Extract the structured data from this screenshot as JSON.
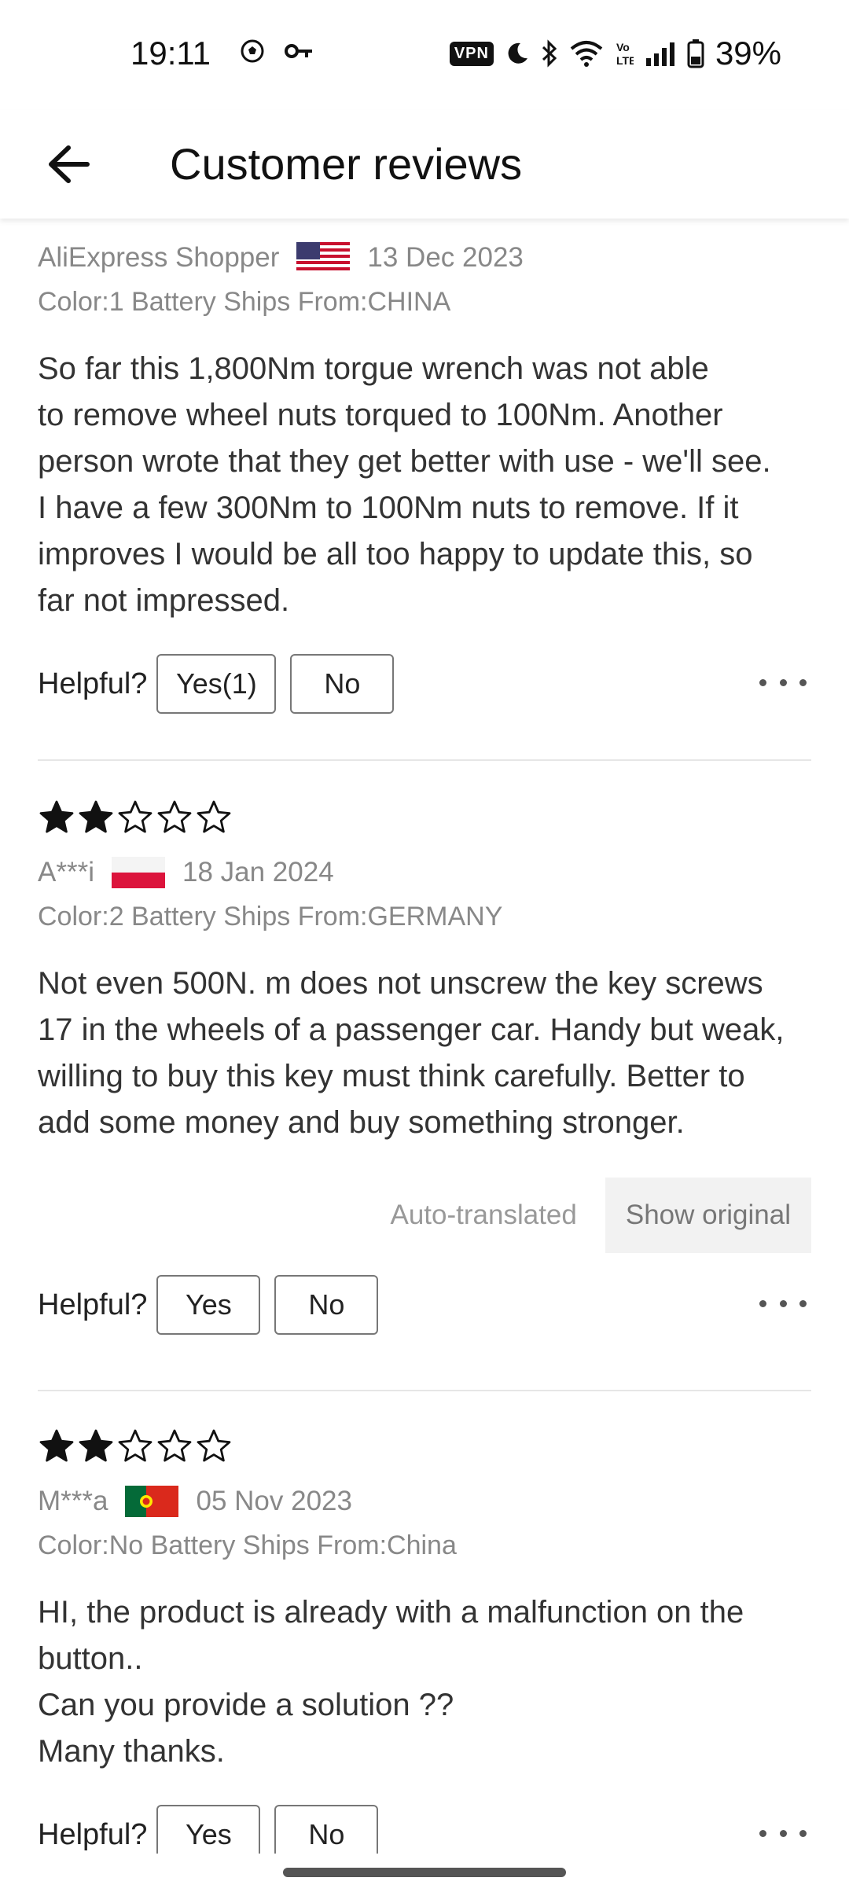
{
  "status_bar": {
    "time": "19:11",
    "vpn_label": "VPN",
    "battery_pct": "39%",
    "icons": [
      "soccer-ball-icon",
      "key-icon",
      "vpn-icon",
      "moon-icon",
      "bluetooth-icon",
      "wifi-icon",
      "volte-icon",
      "signal-icon",
      "battery-icon"
    ]
  },
  "header": {
    "title": "Customer reviews",
    "back_icon": "arrow-left-icon"
  },
  "reviews": [
    {
      "author": "AliExpress Shopper",
      "country_flag": "flag-usa-icon",
      "date": "13 Dec 2023",
      "specs": "Color:1 Battery Ships From:CHINA",
      "text": "So far this 1,800Nm torgue wrench was not able\nto remove wheel nuts torqued to 100Nm.  Another\nperson wrote that they get better with use - we'll see.\nI have a few 300Nm to 100Nm nuts to remove. If it\nimproves I would be all too happy to update this, so\nfar not impressed.",
      "helpful_label": "Helpful?",
      "yes_label": "Yes(1)",
      "no_label": "No"
    },
    {
      "rating": 2,
      "max_rating": 5,
      "author": "A***i",
      "country_flag": "flag-poland-icon",
      "date": "18 Jan 2024",
      "specs": "Color:2 Battery Ships From:GERMANY",
      "text": "Not even 500N. m does not unscrew the key screws\n17 in the wheels of a passenger car. Handy but weak,\nwilling to buy this key must think carefully. Better to\nadd some money and buy something stronger.",
      "auto_translated": "Auto-translated",
      "show_original": "Show original",
      "helpful_label": "Helpful?",
      "yes_label": "Yes",
      "no_label": "No"
    },
    {
      "rating": 2,
      "max_rating": 5,
      "author": "M***a",
      "country_flag": "flag-portugal-icon",
      "date": "05 Nov 2023",
      "specs": "Color:No Battery Ships From:China",
      "text": "HI, the product is already with a malfunction on the\nbutton..\nCan you provide a solution ??\nMany thanks.",
      "helpful_label": "Helpful?",
      "yes_label": "Yes",
      "no_label": "No"
    }
  ],
  "colors": {
    "star": "#111111",
    "muted_text": "#888888",
    "button_border": "#777777"
  }
}
